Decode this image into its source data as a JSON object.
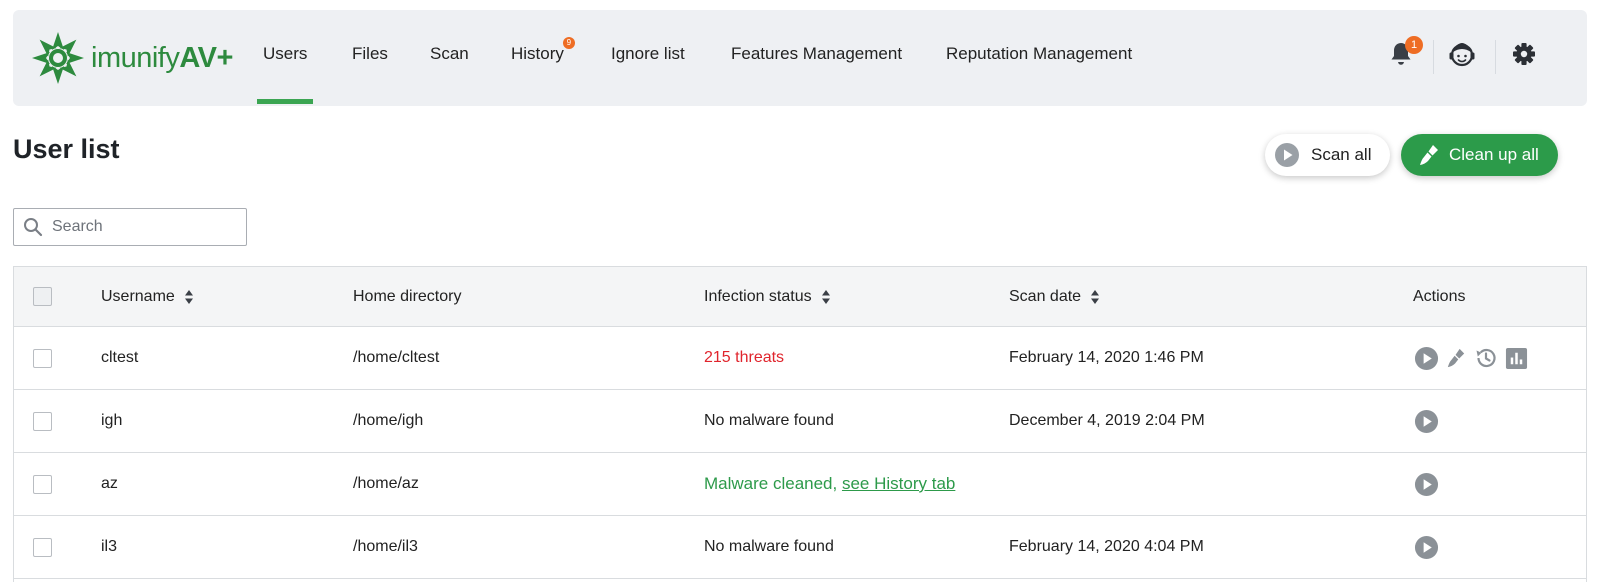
{
  "brand": {
    "name": "imunify",
    "suffix": "AV+"
  },
  "nav": {
    "tabs": [
      {
        "label": "Users",
        "active": true
      },
      {
        "label": "Files"
      },
      {
        "label": "Scan"
      },
      {
        "label": "History",
        "badge": "9"
      },
      {
        "label": "Ignore list"
      },
      {
        "label": "Features Management"
      },
      {
        "label": "Reputation Management"
      }
    ],
    "notifications_count": "1",
    "icons": [
      "bell-icon",
      "support-agent-icon",
      "gear-icon"
    ]
  },
  "page": {
    "title": "User list",
    "scan_all_label": "Scan all",
    "clean_up_all_label": "Clean up all"
  },
  "search": {
    "placeholder": "Search",
    "value": ""
  },
  "table": {
    "columns": [
      "Username",
      "Home directory",
      "Infection status",
      "Scan date",
      "Actions"
    ],
    "rows": [
      {
        "username": "cltest",
        "home": "/home/cltest",
        "status": "215 threats",
        "scan_date": "February 14, 2020 1:46 PM",
        "actions": [
          "play-icon",
          "broom-icon",
          "history-icon",
          "report-icon"
        ]
      },
      {
        "username": "igh",
        "home": "/home/igh",
        "status": "No malware found",
        "scan_date": "December 4, 2019 2:04 PM",
        "actions": [
          "play-icon"
        ]
      },
      {
        "username": "az",
        "home": "/home/az",
        "status": "Malware cleaned, ",
        "status_link": "see History tab",
        "scan_date": "",
        "actions": [
          "play-icon"
        ]
      },
      {
        "username": "il3",
        "home": "/home/il3",
        "status": "No malware found",
        "scan_date": "February 14, 2020 4:04 PM",
        "actions": [
          "play-icon"
        ]
      }
    ]
  },
  "colors": {
    "brand_green": "#2d8a3e",
    "active_tab": "#3ba552",
    "primary_button": "#2c9b4a",
    "badge_orange": "#ee6d24",
    "threat_red": "#e0242c",
    "cleaned_green": "#2d9a4a"
  }
}
